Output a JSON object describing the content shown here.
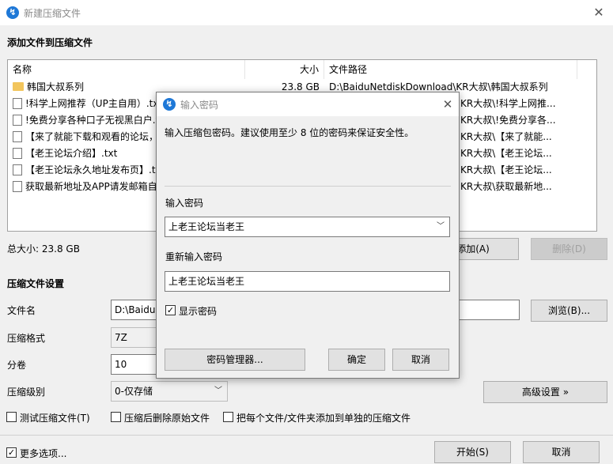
{
  "window": {
    "title": "新建压缩文件",
    "close_glyph": "✕"
  },
  "add_section": {
    "label": "添加文件到压缩文件"
  },
  "filelist": {
    "columns": {
      "name": "名称",
      "size": "大小",
      "path": "文件路径"
    },
    "rows": [
      {
        "icon": "folder-icon",
        "name": "韩国大叔系列",
        "size": "23.8 GB",
        "path": "D:\\BaiduNetdiskDownload\\KR大叔\\韩国大叔系列"
      },
      {
        "icon": "file-icon",
        "name": "!科学上网推荐（UP主自用）.txt",
        "size": "",
        "path": "KR大叔\\!科学上网推..."
      },
      {
        "icon": "file-icon",
        "name": "!免费分享各种口子无视黑白户.txt",
        "size": "",
        "path": "KR大叔\\!免费分享各..."
      },
      {
        "icon": "file-icon",
        "name": "【来了就能下载和观看的论坛，",
        "size": "",
        "path": "KR大叔\\【来了就能..."
      },
      {
        "icon": "file-icon",
        "name": "【老王论坛介绍】.txt",
        "size": "",
        "path": "KR大叔\\【老王论坛..."
      },
      {
        "icon": "file-icon",
        "name": "【老王论坛永久地址发布页】.txt",
        "size": "",
        "path": "KR大叔\\【老王论坛..."
      },
      {
        "icon": "file-icon",
        "name": "获取最新地址及APP请发邮箱自动获取",
        "size": "",
        "path": "KR大叔\\获取最新地..."
      }
    ]
  },
  "total_size": "总大小: 23.8 GB",
  "buttons": {
    "add": "添加(A)",
    "delete": "删除(D)",
    "browse": "浏览(B)...",
    "advanced": "高级设置 »",
    "start": "开始(S)",
    "cancel_main": "取消"
  },
  "settings": {
    "section_label": "压缩文件设置",
    "filename_label": "文件名",
    "filename_value": "D:\\BaiduN",
    "format_label": "压缩格式",
    "format_value": "7Z",
    "volume_label": "分卷",
    "volume_value": "10",
    "level_label": "压缩级别",
    "level_value": "0-仅存储"
  },
  "options": {
    "test_archive": "测试压缩文件(T)",
    "delete_after": "压缩后删除原始文件",
    "separate_archives": "把每个文件/文件夹添加到单独的压缩文件",
    "more_options": "更多选项..."
  },
  "dialog": {
    "title": "输入密码",
    "close_glyph": "✕",
    "description": "输入压缩包密码。建议使用至少 8 位的密码来保证安全性。",
    "password_label": "输入密码",
    "password_value": "上老王论坛当老王",
    "reenter_label": "重新输入密码",
    "reenter_value": "上老王论坛当老王",
    "show_password_label": "显示密码",
    "manager_button": "密码管理器...",
    "ok_button": "确定",
    "cancel_button": "取消"
  },
  "colors": {
    "accent": "#1e78d7",
    "folder": "#f2c55c"
  }
}
